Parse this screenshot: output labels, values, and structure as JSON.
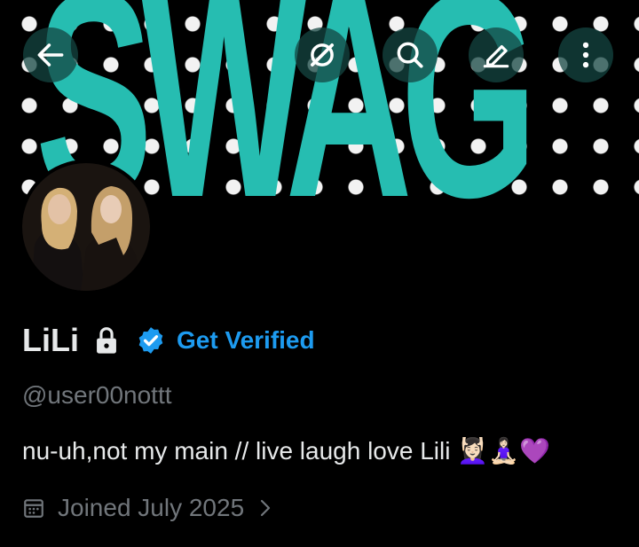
{
  "banner": {
    "word": "SWAG"
  },
  "profile": {
    "display_name": "LiLi",
    "verify_label": "Get Verified",
    "handle": "@user00nottt",
    "bio": "nu-uh,not my main // live laugh love Lili 💆🏻‍♀️🧘🏻‍♀️💜",
    "joined": "Joined July 2025"
  },
  "icons": {
    "back": "arrow-left-icon",
    "grok": "grok-icon",
    "search": "search-icon",
    "edit": "edit-icon",
    "more": "more-vertical-icon",
    "lock": "lock-icon",
    "verified": "verified-badge-icon",
    "calendar": "calendar-icon",
    "chevron": "chevron-right-icon"
  },
  "colors": {
    "accent": "#1d9bf0",
    "banner_text": "#26bdb1",
    "muted": "#71767b",
    "text": "#e7e9ea"
  }
}
